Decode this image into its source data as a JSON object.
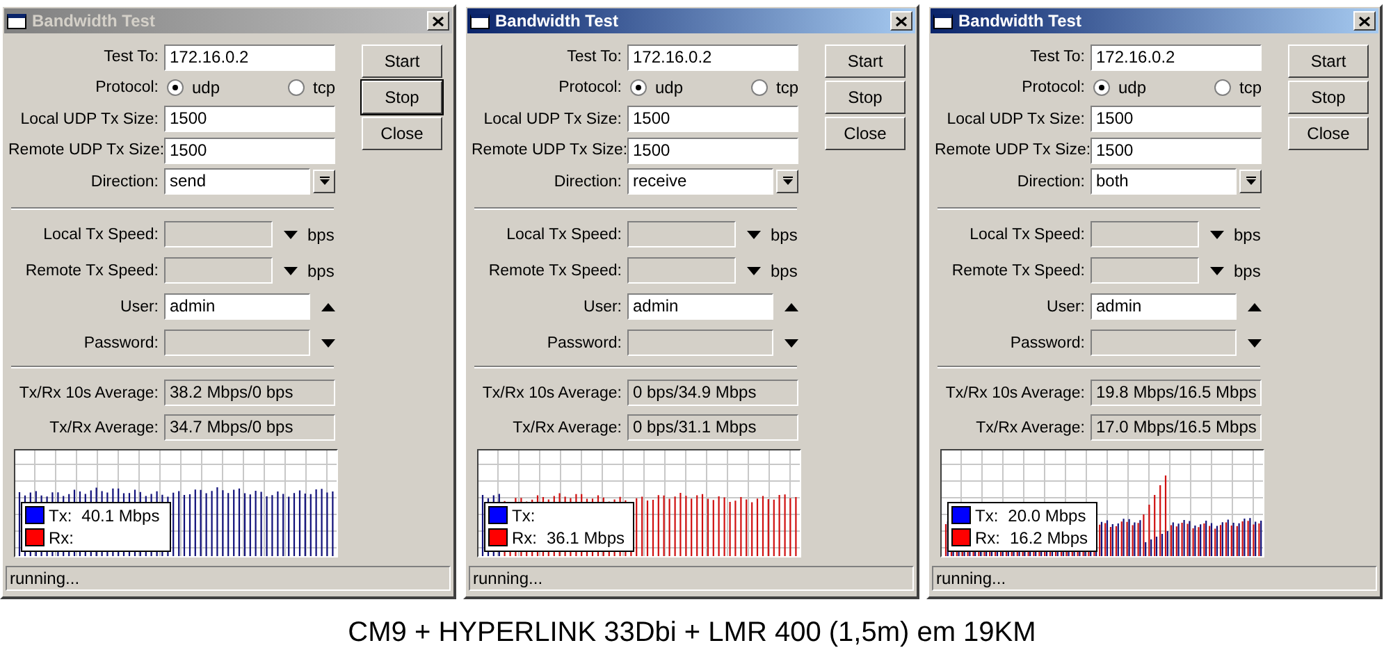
{
  "windows": [
    {
      "title": "Bandwidth Test",
      "active": false,
      "fields": [
        {
          "kind": "text",
          "label": "Test To:",
          "value": "172.16.0.2"
        },
        {
          "kind": "radio",
          "label": "Protocol:",
          "options": [
            {
              "label": "udp",
              "selected": true
            },
            {
              "label": "tcp",
              "selected": false
            }
          ]
        },
        {
          "kind": "text",
          "label": "Local UDP Tx Size:",
          "value": "1500"
        },
        {
          "kind": "text",
          "label": "Remote UDP Tx Size:",
          "value": "1500"
        },
        {
          "kind": "select",
          "label": "Direction:",
          "value": "send"
        }
      ],
      "options": [
        {
          "kind": "speed",
          "label": "Local Tx Speed:",
          "unit": "bps",
          "disabled": true,
          "expanded": false
        },
        {
          "kind": "speed",
          "label": "Remote Tx Speed:",
          "unit": "bps",
          "disabled": true,
          "expanded": false
        },
        {
          "kind": "toggle",
          "label": "User:",
          "value": "admin",
          "disabled": false,
          "expanded": true
        },
        {
          "kind": "toggle",
          "label": "Password:",
          "disabled": true,
          "expanded": false
        }
      ],
      "averages": [
        {
          "label": "Tx/Rx 10s Average:",
          "value": "38.2 Mbps/0 bps"
        },
        {
          "label": "Tx/Rx Average:",
          "value": "34.7 Mbps/0 bps"
        }
      ],
      "graph": {
        "kind": "send",
        "legend": [
          {
            "label": "Tx:",
            "value": "40.1 Mbps",
            "color": "#0000ff"
          },
          {
            "label": "Rx:",
            "color": "#ff0000"
          }
        ]
      },
      "buttons": [
        {
          "label": "Start",
          "focused": false
        },
        {
          "label": "Stop",
          "focused": true
        },
        {
          "label": "Close",
          "focused": false
        }
      ],
      "status": "running..."
    },
    {
      "title": "Bandwidth Test",
      "active": true,
      "fields": [
        {
          "kind": "text",
          "label": "Test To:",
          "value": "172.16.0.2"
        },
        {
          "kind": "radio",
          "label": "Protocol:",
          "options": [
            {
              "label": "udp",
              "selected": true
            },
            {
              "label": "tcp",
              "selected": false
            }
          ]
        },
        {
          "kind": "text",
          "label": "Local UDP Tx Size:",
          "value": "1500"
        },
        {
          "kind": "text",
          "label": "Remote UDP Tx Size:",
          "value": "1500"
        },
        {
          "kind": "select",
          "label": "Direction:",
          "value": "receive"
        }
      ],
      "options": [
        {
          "kind": "speed",
          "label": "Local Tx Speed:",
          "unit": "bps",
          "disabled": true,
          "expanded": false
        },
        {
          "kind": "speed",
          "label": "Remote Tx Speed:",
          "unit": "bps",
          "disabled": true,
          "expanded": false
        },
        {
          "kind": "toggle",
          "label": "User:",
          "value": "admin",
          "disabled": false,
          "expanded": true
        },
        {
          "kind": "toggle",
          "label": "Password:",
          "disabled": true,
          "expanded": false
        }
      ],
      "averages": [
        {
          "label": "Tx/Rx 10s Average:",
          "value": "0 bps/34.9 Mbps"
        },
        {
          "label": "Tx/Rx Average:",
          "value": "0 bps/31.1 Mbps"
        }
      ],
      "graph": {
        "kind": "receive",
        "legend": [
          {
            "label": "Tx:",
            "color": "#0000ff"
          },
          {
            "label": "Rx:",
            "value": "36.1 Mbps",
            "color": "#ff0000"
          }
        ]
      },
      "buttons": [
        {
          "label": "Start",
          "focused": false
        },
        {
          "label": "Stop",
          "focused": false
        },
        {
          "label": "Close",
          "focused": false
        }
      ],
      "status": "running..."
    },
    {
      "title": "Bandwidth Test",
      "active": true,
      "fields": [
        {
          "kind": "text",
          "label": "Test To:",
          "value": "172.16.0.2"
        },
        {
          "kind": "radio",
          "label": "Protocol:",
          "options": [
            {
              "label": "udp",
              "selected": true
            },
            {
              "label": "tcp",
              "selected": false
            }
          ]
        },
        {
          "kind": "text",
          "label": "Local UDP Tx Size:",
          "value": "1500"
        },
        {
          "kind": "text",
          "label": "Remote UDP Tx Size:",
          "value": "1500"
        },
        {
          "kind": "select",
          "label": "Direction:",
          "value": "both"
        }
      ],
      "options": [
        {
          "kind": "speed",
          "label": "Local Tx Speed:",
          "unit": "bps",
          "disabled": true,
          "expanded": false
        },
        {
          "kind": "speed",
          "label": "Remote Tx Speed:",
          "unit": "bps",
          "disabled": true,
          "expanded": false
        },
        {
          "kind": "toggle",
          "label": "User:",
          "value": "admin",
          "disabled": false,
          "expanded": true
        },
        {
          "kind": "toggle",
          "label": "Password:",
          "disabled": true,
          "expanded": false
        }
      ],
      "averages": [
        {
          "label": "Tx/Rx 10s Average:",
          "value": "19.8 Mbps/16.5 Mbps"
        },
        {
          "label": "Tx/Rx Average:",
          "value": "17.0 Mbps/16.5 Mbps"
        }
      ],
      "graph": {
        "kind": "both",
        "legend": [
          {
            "label": "Tx:",
            "value": "20.0 Mbps",
            "color": "#0000ff"
          },
          {
            "label": "Rx:",
            "value": "16.2 Mbps",
            "color": "#ff0000"
          }
        ]
      },
      "buttons": [
        {
          "label": "Start",
          "focused": false
        },
        {
          "label": "Stop",
          "focused": false
        },
        {
          "label": "Close",
          "focused": false
        }
      ],
      "status": "running..."
    }
  ],
  "caption": "CM9 + HYPERLINK 33Dbi + LMR 400 (1,5m) em 19KM"
}
